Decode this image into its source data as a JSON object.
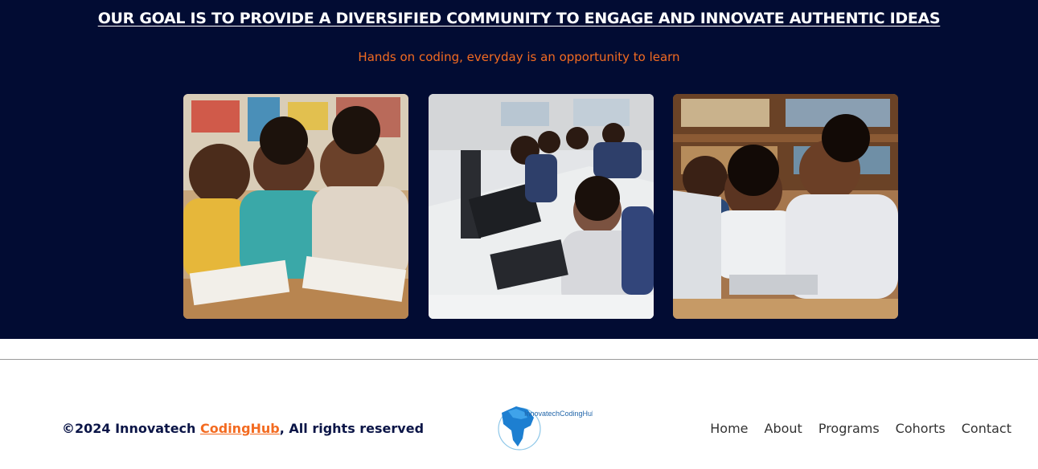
{
  "hero": {
    "title": "OUR GOAL IS TO PROVIDE A DIVERSIFIED COMMUNITY TO ENGAGE AND INNOVATE AUTHENTIC IDEAS",
    "subtitle": "Hands on coding, everyday is an opportunity to learn",
    "background_color": "#020c33",
    "accent_color": "#f36b21"
  },
  "gallery": {
    "images": [
      {
        "name": "photo-children-writing"
      },
      {
        "name": "photo-computer-lab"
      },
      {
        "name": "photo-students-laptops"
      }
    ]
  },
  "footer": {
    "copyright_prefix": "©2024 Innovatech ",
    "copyright_link": "CodingHub",
    "copyright_suffix": ", All rights reserved",
    "logo_text": "InnovatechCodingHub",
    "nav": [
      "Home",
      "About",
      "Programs",
      "Cohorts",
      "Contact"
    ]
  }
}
